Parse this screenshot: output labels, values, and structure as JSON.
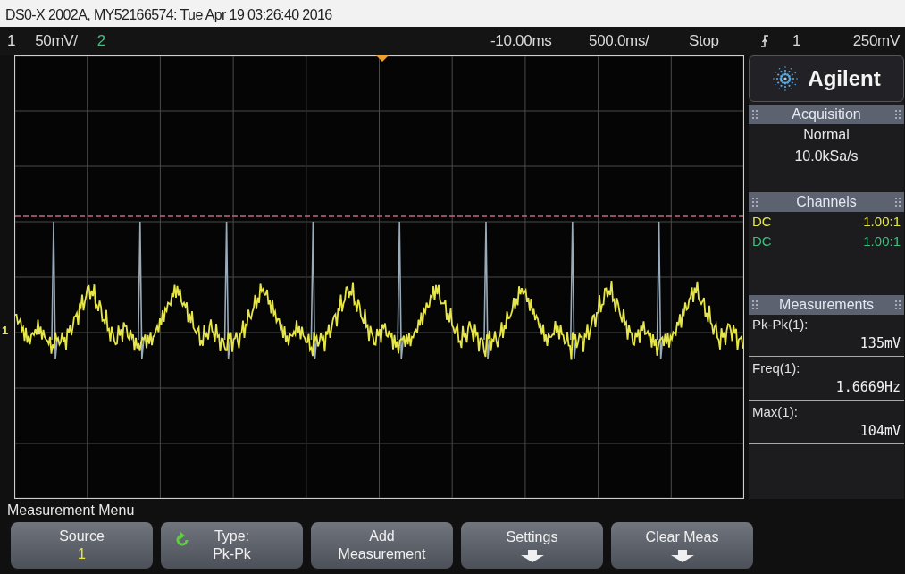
{
  "caption": "DS0-X 2002A, MY52166574: Tue Apr 19 03:26:40 2016",
  "top_bar": {
    "channels": [
      {
        "label": "1",
        "scale": "50mV/",
        "color": "#e0e0e0"
      },
      {
        "label": "2",
        "color": "#3fbf7f"
      }
    ],
    "delay": "-10.00ms",
    "timebase": "500.0ms/",
    "run_state": "Stop",
    "trigger_source": "1",
    "trigger_level": "250mV"
  },
  "ground_marker": {
    "label": "1",
    "color": "#e6e64a"
  },
  "brand": "Agilent",
  "acquisition": {
    "title": "Acquisition",
    "mode": "Normal",
    "sample_rate": "10.0kSa/s"
  },
  "channels": {
    "title": "Channels",
    "rows": [
      {
        "coupling": "DC",
        "probe": "1.00:1",
        "color": "#e6e64a"
      },
      {
        "coupling": "DC",
        "probe": "1.00:1",
        "color": "#3fbf7f"
      }
    ]
  },
  "measurements": {
    "title": "Measurements",
    "items": [
      {
        "label": "Pk-Pk(1):",
        "value": "135mV"
      },
      {
        "label": "Freq(1):",
        "value": "1.6669Hz"
      },
      {
        "label": "Max(1):",
        "value": "104mV"
      }
    ]
  },
  "menu": {
    "title": "Measurement Menu",
    "softkeys": [
      {
        "kind": "value",
        "label": "Source",
        "value": "1"
      },
      {
        "kind": "cycle",
        "label": "Type:",
        "value": "Pk-Pk"
      },
      {
        "kind": "plain",
        "label": "Add",
        "value": "Measurement"
      },
      {
        "kind": "submenu",
        "label": "Settings"
      },
      {
        "kind": "submenu",
        "label": "Clear Meas"
      }
    ]
  }
}
